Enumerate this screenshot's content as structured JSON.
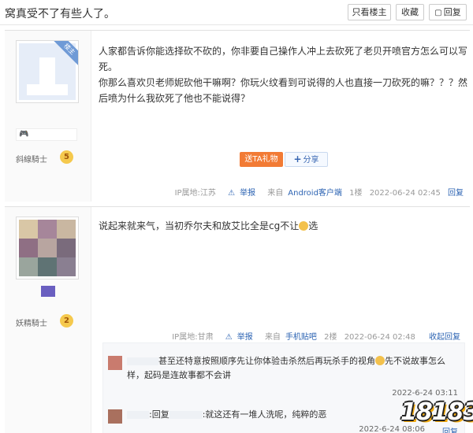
{
  "header": {
    "thread_title": "窝真受不了有些人了。",
    "only_host_label": "只看楼主",
    "favorite_label": "收藏",
    "reply_label": "回复"
  },
  "posts": [
    {
      "host_badge": "楼主",
      "rank_name": "斜線騎士",
      "level": "5",
      "paragraphs": [
        "人家都告诉你能选择砍不砍的，你非要自己操作人冲上去砍死了老贝开喷官方怎么可以写死。",
        "你那么喜欢贝老师妮砍他干嘛啊？你玩火纹看到可说得的人也直接一刀砍死的嘛？？？然后喷为什么我砍死了他也不能说得？"
      ],
      "gift_label": "送TA礼物",
      "share_label": "分享",
      "ip": "IP属地:江苏",
      "report_label": "举报",
      "source_prefix": "来自",
      "source": "Android客户端",
      "floor": "1楼",
      "time": "2022-06-24 02:45",
      "reply_label": "回复"
    },
    {
      "rank_name": "妖精騎士",
      "level": "2",
      "text_before": "说起来就来气，当初乔尔夫和放艾比全是cg不让",
      "text_after": "选",
      "ip": "IP属地:甘肃",
      "report_label": "举报",
      "source_prefix": "来自",
      "source": "手机贴吧",
      "floor": "2楼",
      "time": "2022-06-24 02:48",
      "collapse_label": "收起回复"
    }
  ],
  "comments": [
    {
      "text": "甚至还特意按照顺序先让你体验击杀然后再玩杀手的视角",
      "text_after": "先不说故事怎么样，起码是连故事都不会讲",
      "time": "2022-6-24 03:11"
    },
    {
      "reply_prefix": ":回复",
      "text": ":就这还有一堆人洗呢，纯粹的恶",
      "time": "2022-6-24 08:06",
      "reply_label": "回复"
    }
  ],
  "watermark": "18183",
  "colors": {
    "accent": "#2d64b3",
    "gift": "#f27b35",
    "level_badge": "#f5c94d"
  }
}
